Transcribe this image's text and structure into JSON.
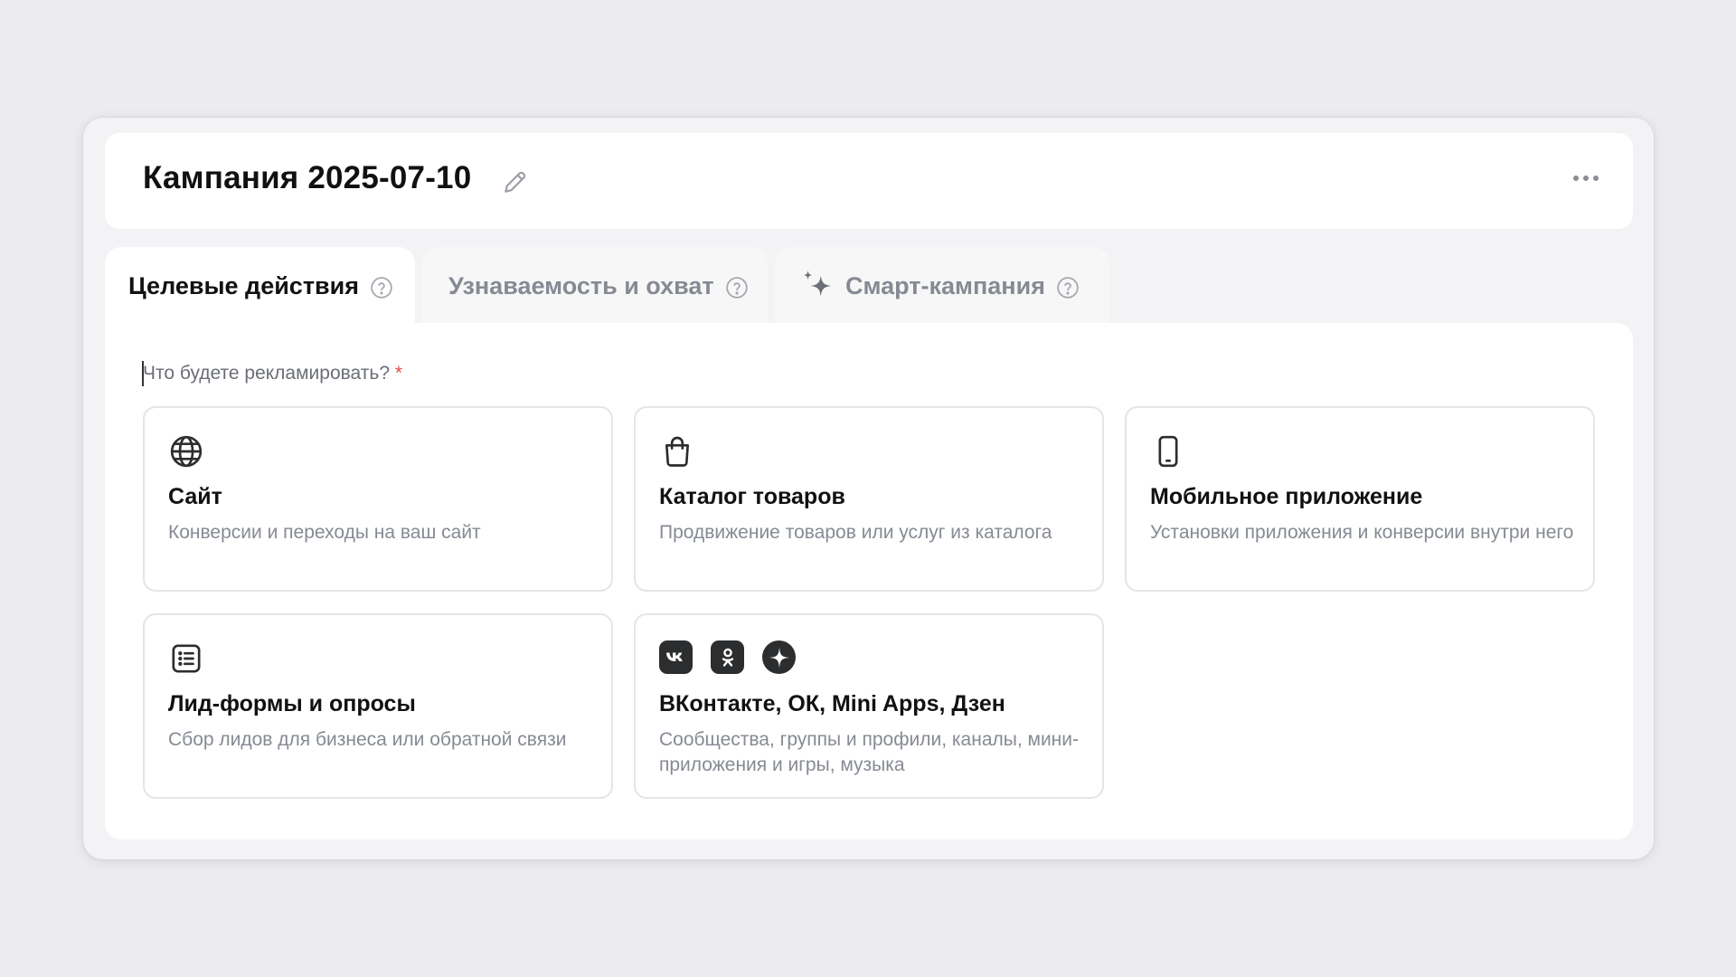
{
  "header": {
    "title": "Кампания 2025-07-10"
  },
  "tabs": [
    {
      "label": "Целевые действия",
      "active": true
    },
    {
      "label": "Узнаваемость и охват",
      "active": false
    },
    {
      "label": "Смарт-кампания",
      "active": false
    }
  ],
  "form": {
    "question": "Что будете рекламировать?",
    "required_mark": "*"
  },
  "cards": [
    {
      "icon": "globe-icon",
      "title": "Сайт",
      "description": "Конверсии и переходы на ваш сайт"
    },
    {
      "icon": "shopping-bag-icon",
      "title": "Каталог товаров",
      "description": "Продвижение товаров или услуг из каталога"
    },
    {
      "icon": "smartphone-icon",
      "title": "Мобильное приложение",
      "description": "Установки приложения и конверсии внутри него"
    },
    {
      "icon": "list-form-icon",
      "title": "Лид-формы и опросы",
      "description": "Сбор лидов для бизнеса или обратной связи"
    },
    {
      "icon": "vk-ok-dzen-icons",
      "title": "ВКонтакте, ОК, Mini Apps, Дзен",
      "description": "Сообщества, группы и профили, каналы, мини-приложения и игры, музыка"
    }
  ],
  "colors": {
    "background": "#ebebf0",
    "required": "#e5484d",
    "muted_text": "#868a93",
    "card_border": "#e4e5e8"
  }
}
